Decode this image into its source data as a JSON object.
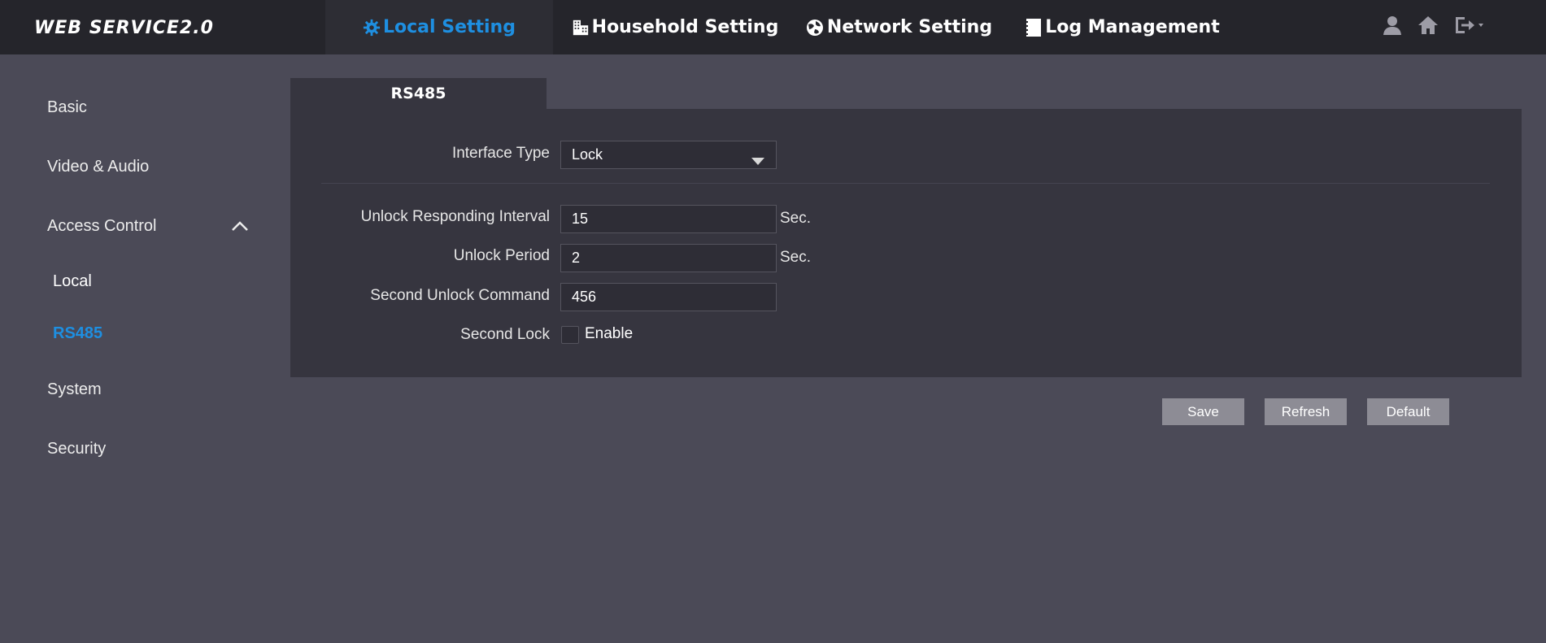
{
  "header": {
    "logo": "WEB SERVICE2.0",
    "tabs": [
      {
        "label": "Local Setting",
        "icon": "gear-icon",
        "active": true
      },
      {
        "label": "Household Setting",
        "icon": "building-icon",
        "active": false
      },
      {
        "label": "Network Setting",
        "icon": "globe-icon",
        "active": false
      },
      {
        "label": "Log Management",
        "icon": "log-icon",
        "active": false
      }
    ],
    "icons": [
      "user-icon",
      "home-icon",
      "logout-icon"
    ]
  },
  "sidebar": {
    "items": [
      {
        "label": "Basic"
      },
      {
        "label": "Video & Audio"
      },
      {
        "label": "Access Control",
        "expanded": true
      },
      {
        "label": "System"
      },
      {
        "label": "Security"
      }
    ],
    "subitems": [
      {
        "label": "Local"
      },
      {
        "label": "RS485",
        "active": true
      }
    ]
  },
  "panel": {
    "tab": "RS485",
    "interface_type": {
      "label": "Interface Type",
      "value": "Lock"
    },
    "unlock_interval": {
      "label": "Unlock Responding Interval",
      "value": "15",
      "unit": "Sec."
    },
    "unlock_period": {
      "label": "Unlock Period",
      "value": "2",
      "unit": "Sec."
    },
    "second_command": {
      "label": "Second Unlock Command",
      "value": "456"
    },
    "second_lock": {
      "label": "Second Lock",
      "checkbox_label": "Enable",
      "checked": false
    }
  },
  "buttons": {
    "save": "Save",
    "refresh": "Refresh",
    "default": "Default"
  },
  "colors": {
    "accent": "#1e8fe1",
    "topbar": "#25252b",
    "background": "#4b4a57",
    "panel": "#36353f"
  }
}
